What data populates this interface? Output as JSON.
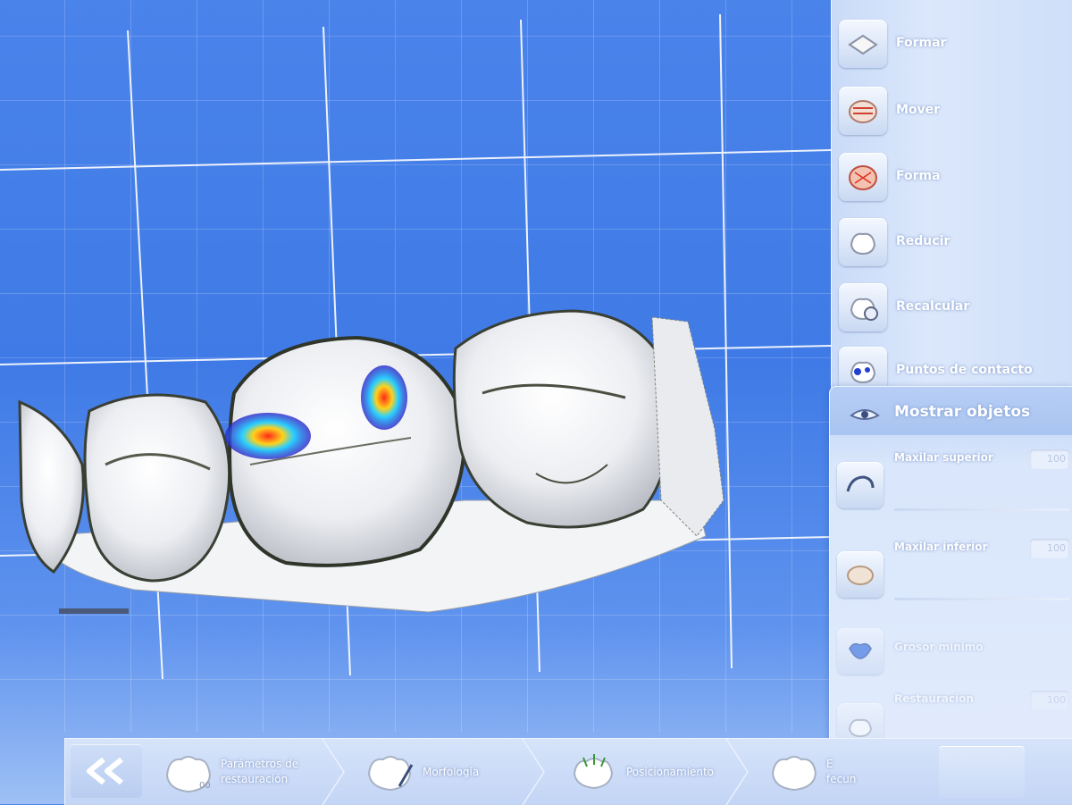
{
  "tools": [
    {
      "label": "Formar",
      "icon": "form-icon"
    },
    {
      "label": "Mover",
      "icon": "move-icon"
    },
    {
      "label": "Forma",
      "icon": "shape-icon"
    },
    {
      "label": "Reducir",
      "icon": "reduce-icon"
    },
    {
      "label": "Recalcular",
      "icon": "recalculate-icon"
    },
    {
      "label": "Puntos de contacto",
      "icon": "contact-points-icon"
    }
  ],
  "objects_panel": {
    "title": "Mostrar objetos",
    "items": [
      {
        "label": "Maxilar superior",
        "value": "100",
        "icon": "upper-jaw-icon"
      },
      {
        "label": "Maxilar inferior",
        "value": "100",
        "icon": "lower-jaw-icon"
      },
      {
        "label": "Grosor mínimo",
        "value": "",
        "icon": "minimum-thickness-icon"
      },
      {
        "label": "Restauración",
        "value": "100",
        "icon": "restoration-icon"
      }
    ]
  },
  "bottom_steps": [
    {
      "label": "Parámetros de\nrestauración",
      "icon": "restoration-parameters-icon"
    },
    {
      "label": "Morfología",
      "icon": "morphology-icon"
    },
    {
      "label": "Posicionamiento",
      "icon": "positioning-icon"
    },
    {
      "label": "E\nfecun",
      "icon": "tooth-icon"
    }
  ],
  "colors": {
    "background": "#4a83ea",
    "grid_line": "#ffffff",
    "tooth": "#f2f2f2",
    "contact_high": "#e02020",
    "contact_low": "#2a2ad0"
  }
}
